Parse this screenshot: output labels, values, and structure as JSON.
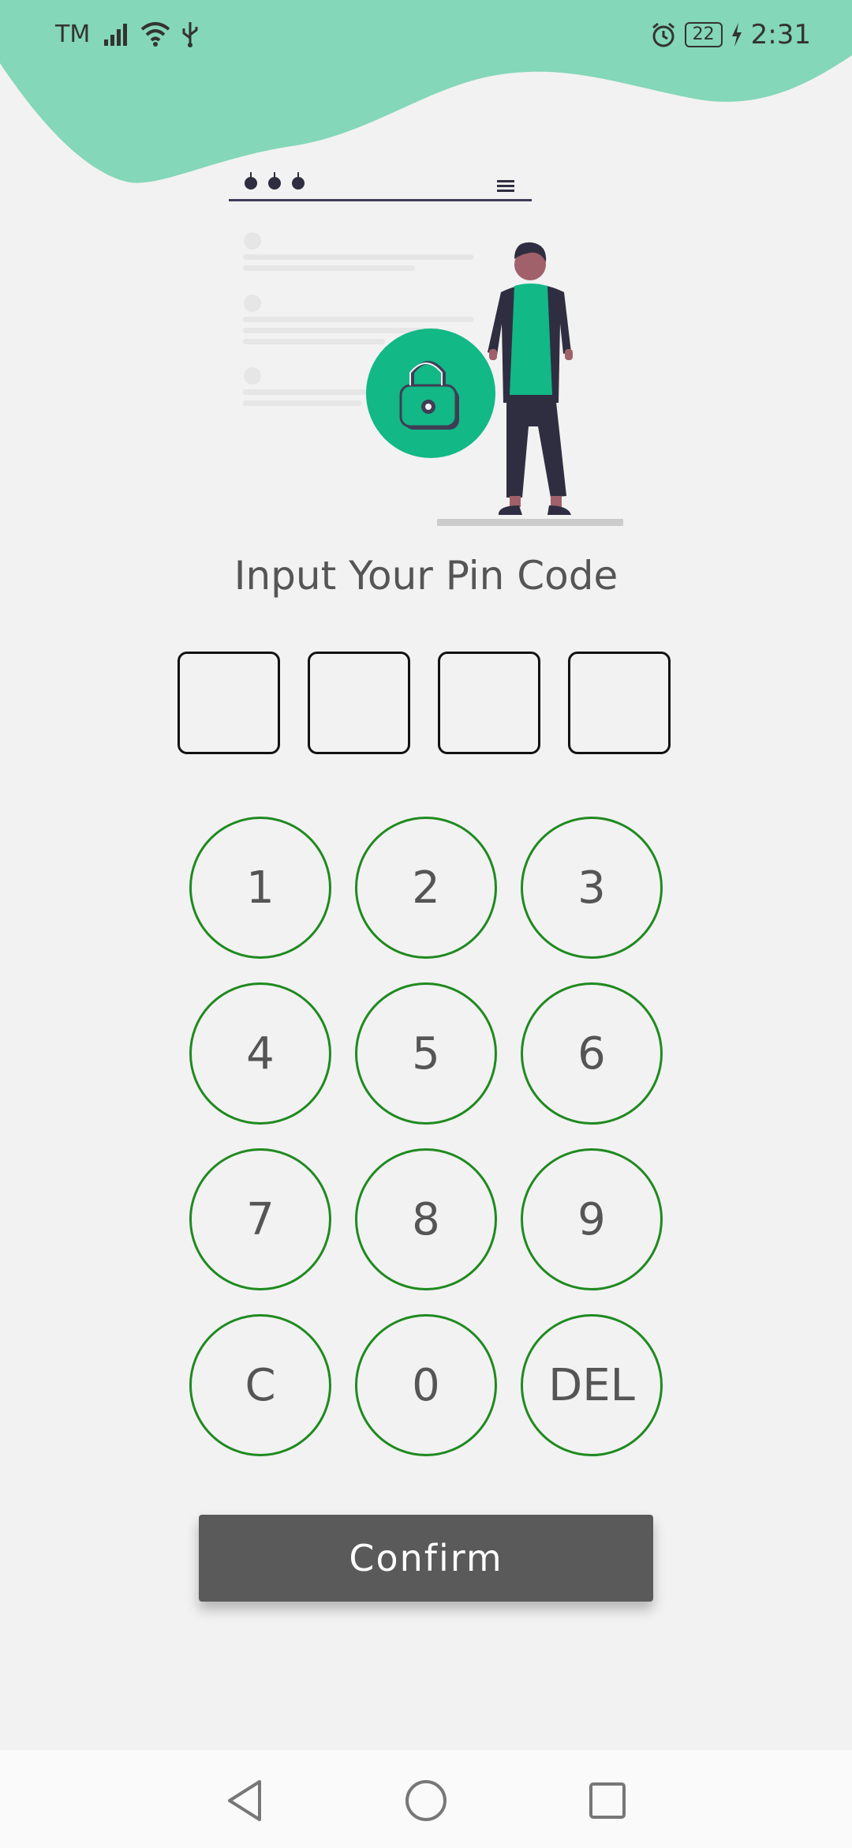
{
  "status_bar": {
    "carrier": "TM",
    "battery": "22",
    "time": "2:31",
    "icons": [
      "signal-icon",
      "wifi-icon",
      "usb-icon",
      "alarm-icon",
      "battery-icon",
      "charging-icon"
    ]
  },
  "page": {
    "title": "Input Your Pin Code"
  },
  "pin": {
    "digits": [
      "",
      "",
      "",
      ""
    ]
  },
  "keypad": {
    "keys": [
      "1",
      "2",
      "3",
      "4",
      "5",
      "6",
      "7",
      "8",
      "9",
      "C",
      "0",
      "DEL"
    ]
  },
  "confirm_label": "Confirm",
  "nav": {
    "icons": [
      "back-icon",
      "home-icon",
      "recents-icon"
    ]
  },
  "colors": {
    "accent": "#84d7b8",
    "illustration_green": "#12b886",
    "key_border": "#1f8a1f",
    "button": "#5a5a5a",
    "background": "#f2f2f2"
  }
}
